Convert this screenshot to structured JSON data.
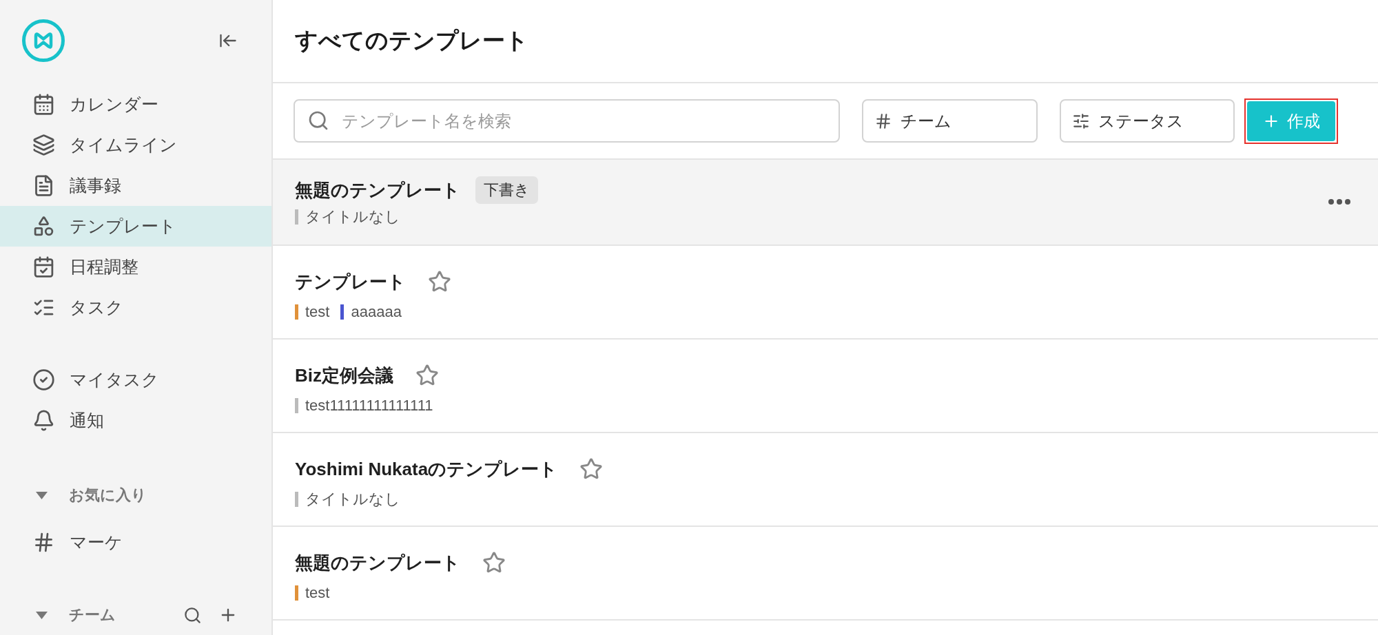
{
  "sidebar": {
    "nav_items": [
      {
        "label": "カレンダー",
        "selected": false
      },
      {
        "label": "タイムライン",
        "selected": false
      },
      {
        "label": "議事録",
        "selected": false
      },
      {
        "label": "テンプレート",
        "selected": true
      },
      {
        "label": "日程調整",
        "selected": false
      },
      {
        "label": "タスク",
        "selected": false
      }
    ],
    "personal_items": [
      {
        "label": "マイタスク",
        "selected": false
      },
      {
        "label": "通知",
        "selected": false
      }
    ],
    "sections": [
      {
        "kind": "favorites",
        "title": "お気に入り",
        "expanded": true,
        "items": [
          {
            "label": "マーケ",
            "selected": false
          }
        ]
      },
      {
        "kind": "teams",
        "title": "チーム",
        "expanded": true
      }
    ]
  },
  "page": {
    "title": "すべてのテンプレート"
  },
  "toolbar": {
    "search": {
      "placeholder": "テンプレート名を検索"
    },
    "filters": [
      {
        "label": "チーム"
      },
      {
        "label": "ステータス"
      }
    ],
    "create_button": {
      "label": "作成",
      "highlighted": true
    }
  },
  "templates": [
    {
      "kind": "draft",
      "title": "無題のテンプレート",
      "badge": "下書き",
      "hovered": true,
      "tags": [
        {
          "label": "タイトルなし",
          "color": "#bbbbbb"
        }
      ]
    },
    {
      "kind": "template",
      "title": "テンプレート",
      "starred": false,
      "hovered": false,
      "tags": [
        {
          "label": "test",
          "color": "#e0913a"
        },
        {
          "label": "aaaaaa",
          "color": "#4a55d0"
        }
      ]
    },
    {
      "kind": "template",
      "title": "Biz定例会議",
      "starred": false,
      "hovered": false,
      "tags": [
        {
          "label": "test11111111111111",
          "color": "#bbbbbb"
        }
      ]
    },
    {
      "kind": "template",
      "title": "Yoshimi Nukataのテンプレート",
      "starred": false,
      "hovered": false,
      "tags": [
        {
          "label": "タイトルなし",
          "color": "#bbbbbb"
        }
      ]
    },
    {
      "kind": "template",
      "title": "無題のテンプレート",
      "starred": false,
      "hovered": false,
      "tags": [
        {
          "label": "test",
          "color": "#e0913a"
        }
      ]
    }
  ]
}
